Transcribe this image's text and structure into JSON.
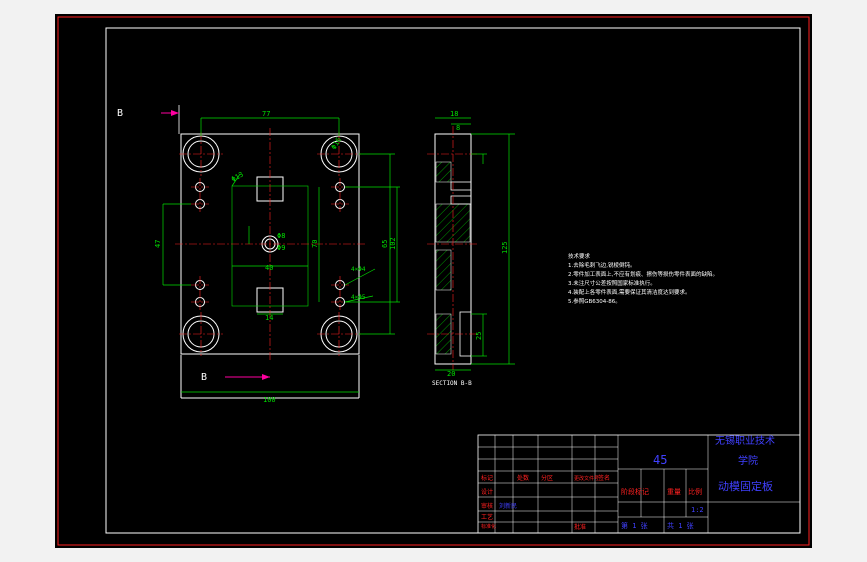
{
  "drawing": {
    "section_marker": "B",
    "section_caption": "SECTION B-B",
    "dims": {
      "width_top": "77",
      "width_bottom": "100",
      "height_left": "47",
      "height_right_a": "70",
      "height_right_b": "65",
      "height_right_c": "102",
      "hole_center": "Φ8",
      "hole_center_b": "Φ9",
      "hole_top_right": "Φ16",
      "hole_angled": "Φ13",
      "inner_width": "40",
      "inner_small": "14",
      "callout_a": "4×Φ4",
      "callout_b": "4×Φ5",
      "side_top_a": "18",
      "side_top_b": "8",
      "side_height": "125",
      "side_small": "25",
      "side_bottom": "20"
    }
  },
  "notes": {
    "title": "技术要求",
    "lines": [
      "1.去除毛刺飞边,锐棱倒钝。",
      "2.零件加工表面上,不应有划痕、擦伤等损伤零件表面的缺陷。",
      "3.未注尺寸公差按照国家标准执行。",
      "4.装配上各零件表面,需要保证其清洁度达到要求。",
      "5.参照GB6304-86。"
    ]
  },
  "title_block": {
    "material": "45",
    "school": "无锡职业技术",
    "school2": "学院",
    "part_name": "动模固定板",
    "left_labels": [
      "标记",
      "设计",
      "审核",
      "工艺",
      "标准化",
      "批准"
    ],
    "row_labels": [
      "处数",
      "分区",
      "更改文件号",
      "签名",
      "年月日"
    ],
    "stage_label": "阶段标记",
    "weight_label": "重量",
    "scale_label": "比例",
    "scale_value": "1:2",
    "sheet_total": "共 1 张",
    "sheet_no": "第 1 张",
    "designer": "刘新民"
  },
  "colors": {
    "border": "#ff2020",
    "part": "#ffffff",
    "dimension": "#00e000",
    "centerline": "#ff2020",
    "hatch": "#00c000",
    "arrow": "#ff00a0",
    "title_text": "#4040ff"
  }
}
